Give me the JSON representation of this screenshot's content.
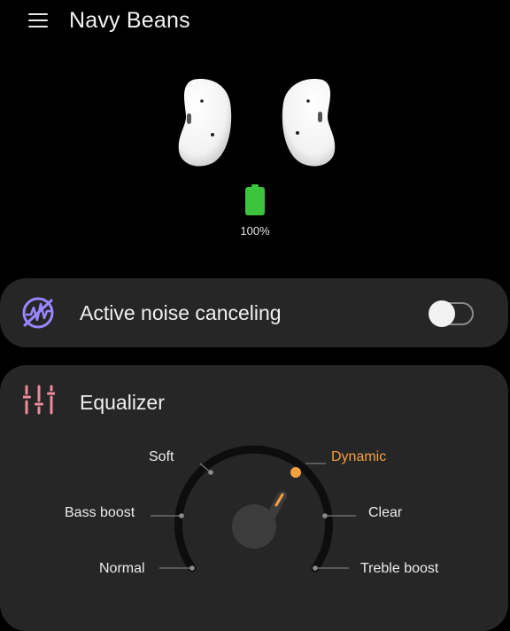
{
  "header": {
    "title": "Navy Beans",
    "menu_icon": "hamburger-menu-icon"
  },
  "device": {
    "battery_text": "100%",
    "battery_level": 1.0,
    "battery_color": "#3cc43c"
  },
  "anc": {
    "label": "Active noise canceling",
    "icon": "noise-canceling-icon",
    "icon_color": "#9a86ff",
    "enabled": false
  },
  "equalizer": {
    "label": "Equalizer",
    "icon": "equalizer-sliders-icon",
    "icon_color": "#f08a9c",
    "selected": "Dynamic",
    "accent_color": "#f4a03d",
    "presets": {
      "soft": "Soft",
      "dynamic": "Dynamic",
      "bass_boost": "Bass boost",
      "clear": "Clear",
      "normal": "Normal",
      "treble_boost": "Treble boost"
    }
  }
}
